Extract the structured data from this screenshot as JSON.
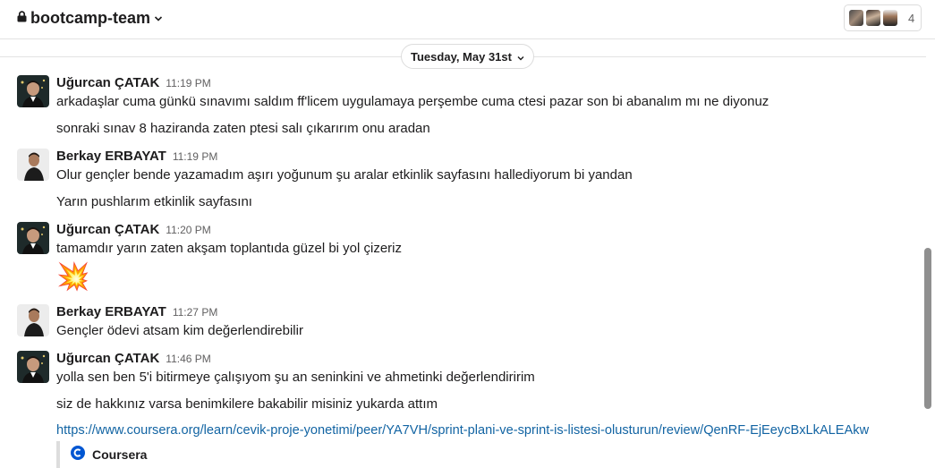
{
  "header": {
    "channel_name": "bootcamp-team",
    "member_count": "4"
  },
  "date_divider": "Tuesday, May 31st",
  "messages": [
    {
      "author": "Uğurcan ÇATAK",
      "time": "11:19 PM",
      "lines": [
        "arkadaşlar cuma günkü sınavımı saldım ff'licem uygulamaya perşembe cuma ctesi pazar son bi abanalım mı ne diyonuz",
        "sonraki sınav 8 haziranda zaten ptesi salı çıkarırım onu aradan"
      ]
    },
    {
      "author": "Berkay ERBAYAT",
      "time": "11:19 PM",
      "lines": [
        "Olur gençler bende yazamadım aşırı yoğunum şu aralar etkinlik sayfasını hallediyorum bi yandan",
        "Yarın pushlarım etkinlik sayfasını"
      ]
    },
    {
      "author": "Uğurcan ÇATAK",
      "time": "11:20 PM",
      "lines": [
        "tamamdır yarın zaten akşam toplantıda güzel bi yol çizeriz"
      ],
      "emoji": "💥"
    },
    {
      "author": "Berkay ERBAYAT",
      "time": "11:27 PM",
      "lines": [
        "Gençler ödevi atsam kim değerlendirebilir"
      ]
    },
    {
      "author": "Uğurcan ÇATAK",
      "time": "11:46 PM",
      "lines": [
        "yolla sen ben 5'i bitirmeye çalışıyom şu an seninkini ve ahmetinki değerlendiririm",
        "siz de hakkınız varsa benimkilere bakabilir misiniz yukarda attım"
      ],
      "link": "https://www.coursera.org/learn/cevik-proje-yonetimi/peer/YA7VH/sprint-plani-ve-sprint-is-listesi-olusturun/review/QenRF-EjEeycBxLkALEAkw",
      "preview_site": "Coursera"
    }
  ],
  "colors": {
    "link": "#1264a3",
    "text": "#1d1c1d",
    "muted": "#616061",
    "coursera_blue": "#0056d2"
  }
}
